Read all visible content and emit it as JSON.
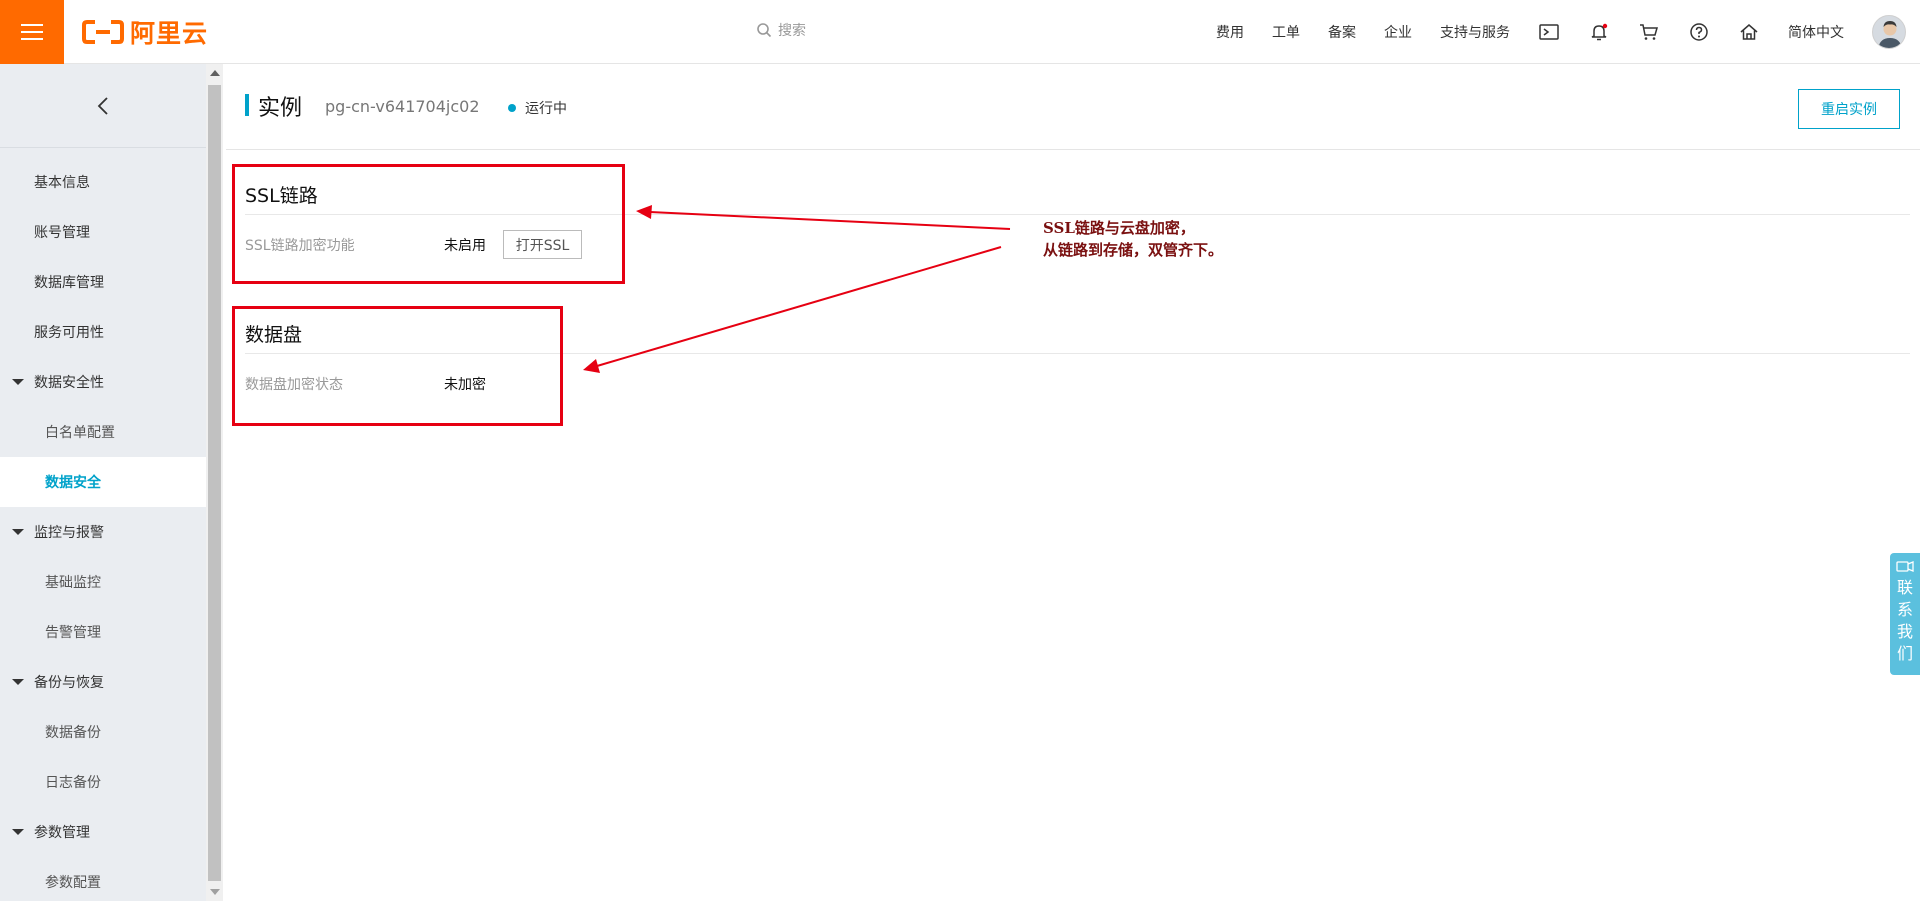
{
  "topbar": {
    "logo_text": "阿里云",
    "search_placeholder": "搜索",
    "nav_items": [
      "费用",
      "工单",
      "备案",
      "企业",
      "支持与服务"
    ],
    "lang": "简体中文"
  },
  "sidebar": {
    "items": [
      {
        "label": "基本信息",
        "kind": "item"
      },
      {
        "label": "账号管理",
        "kind": "item"
      },
      {
        "label": "数据库管理",
        "kind": "item"
      },
      {
        "label": "服务可用性",
        "kind": "item"
      },
      {
        "label": "数据安全性",
        "kind": "group"
      },
      {
        "label": "白名单配置",
        "kind": "sub"
      },
      {
        "label": "数据安全",
        "kind": "sub-active"
      },
      {
        "label": "监控与报警",
        "kind": "group"
      },
      {
        "label": "基础监控",
        "kind": "sub"
      },
      {
        "label": "告警管理",
        "kind": "sub"
      },
      {
        "label": "备份与恢复",
        "kind": "group"
      },
      {
        "label": "数据备份",
        "kind": "sub"
      },
      {
        "label": "日志备份",
        "kind": "sub"
      },
      {
        "label": "参数管理",
        "kind": "group"
      },
      {
        "label": "参数配置",
        "kind": "sub"
      }
    ]
  },
  "page": {
    "title": "实例",
    "instance_id": "pg-cn-v641704jc02",
    "status": "运行中",
    "restart_label": "重启实例"
  },
  "ssl": {
    "title": "SSL链路",
    "label": "SSL链路加密功能",
    "value": "未启用",
    "button": "打开SSL"
  },
  "disk": {
    "title": "数据盘",
    "label": "数据盘加密状态",
    "value": "未加密"
  },
  "annotation": {
    "line1": "SSL链路与云盘加密，",
    "line2": "从链路到存储，双管齐下。"
  },
  "contact": {
    "label": "联系我们"
  },
  "colors": {
    "brand": "#ff6a00",
    "accent": "#00a2ca",
    "highlight": "#e60012",
    "contact": "#5bc0de"
  }
}
